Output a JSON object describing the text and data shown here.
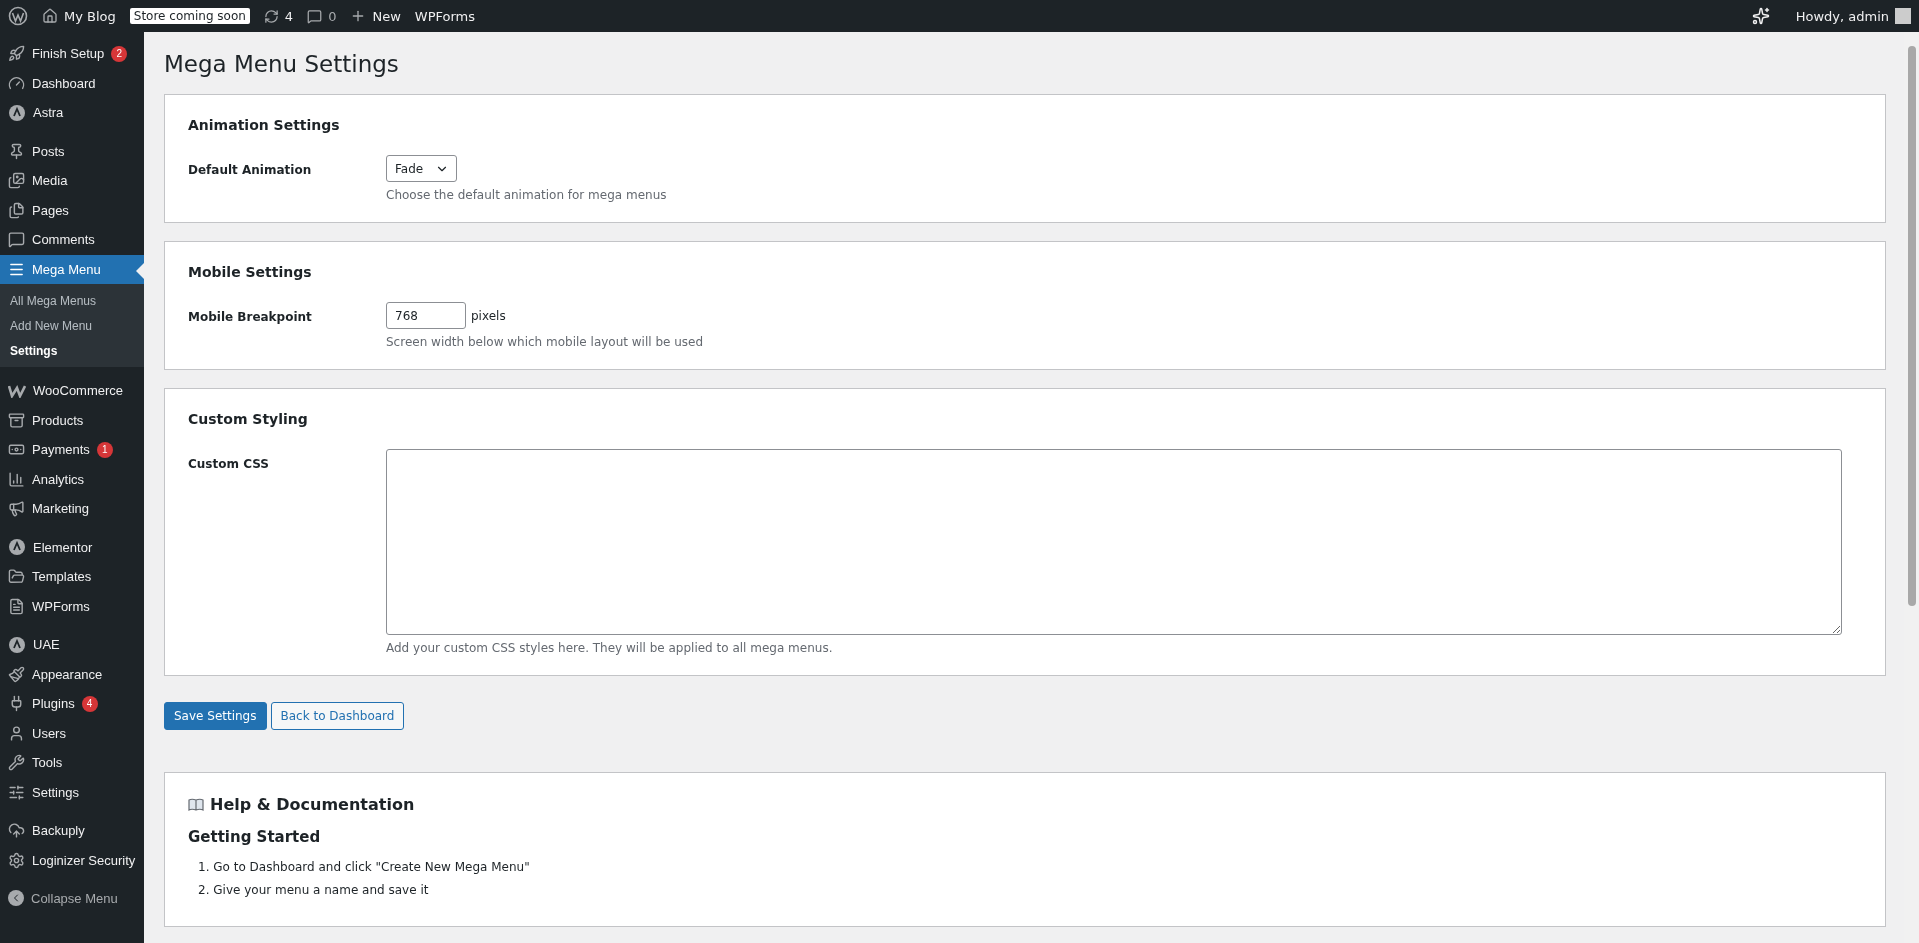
{
  "admin_bar": {
    "site_name": "My Blog",
    "store_notice": "Store coming soon",
    "updates": "4",
    "comments": "0",
    "new_label": "New",
    "plugin_link": "WPForms",
    "greeting": "Howdy, admin"
  },
  "sidebar": {
    "groups": [
      {
        "items": [
          {
            "label": "Finish Setup",
            "badge": "2",
            "selected": false
          },
          {
            "label": "Dashboard",
            "selected": false
          },
          {
            "label": "Astra",
            "selected": false
          }
        ]
      },
      {
        "items": [
          {
            "label": "Posts",
            "selected": false
          },
          {
            "label": "Media",
            "selected": false
          },
          {
            "label": "Pages",
            "selected": false
          },
          {
            "label": "Comments",
            "selected": false
          },
          {
            "label": "Mega Menu",
            "selected": true,
            "children": [
              {
                "label": "All Mega Menus",
                "selected": false
              },
              {
                "label": "Add New Menu",
                "selected": false
              },
              {
                "label": "Settings",
                "selected": true
              }
            ]
          }
        ]
      },
      {
        "items": [
          {
            "label": "WooCommerce",
            "selected": false
          },
          {
            "label": "Products",
            "selected": false
          },
          {
            "label": "Payments",
            "badge": "1",
            "selected": false
          },
          {
            "label": "Analytics",
            "selected": false
          },
          {
            "label": "Marketing",
            "selected": false
          }
        ]
      },
      {
        "items": [
          {
            "label": "Elementor",
            "selected": false
          },
          {
            "label": "Templates",
            "selected": false
          },
          {
            "label": "WPForms",
            "selected": false
          }
        ]
      },
      {
        "items": [
          {
            "label": "UAE",
            "selected": false
          },
          {
            "label": "Appearance",
            "selected": false
          },
          {
            "label": "Plugins",
            "badge": "4",
            "selected": false
          },
          {
            "label": "Users",
            "selected": false
          },
          {
            "label": "Tools",
            "selected": false
          },
          {
            "label": "Settings",
            "selected": false
          }
        ]
      },
      {
        "items": [
          {
            "label": "Backuply",
            "selected": false
          },
          {
            "label": "Loginizer Security",
            "selected": false
          }
        ]
      }
    ],
    "collapse": "Collapse Menu"
  },
  "page_title": "Mega Menu Settings",
  "sections": [
    {
      "title": "Animation Settings",
      "fields": [
        {
          "kind": "select",
          "label": "Default Animation",
          "value": "Fade",
          "description": "Choose the default animation for mega menus"
        }
      ]
    },
    {
      "title": "Mobile Settings",
      "fields": [
        {
          "kind": "number",
          "label": "Mobile Breakpoint",
          "value": "768",
          "unit": "pixels",
          "description": "Screen width below which mobile layout will be used"
        }
      ]
    },
    {
      "title": "Custom Styling",
      "fields": [
        {
          "kind": "textarea",
          "label": "Custom CSS",
          "description": "Add your custom CSS styles here. They will be applied to all mega menus."
        }
      ]
    }
  ],
  "buttons": [
    {
      "kind": "primary",
      "label": "Save Settings"
    },
    {
      "kind": "secondary",
      "label": "Back to Dashboard"
    }
  ],
  "help": {
    "title": "Help & Documentation",
    "subtitle": "Getting Started",
    "steps": [
      "1. Go to Dashboard and click \"Create New Mega Menu\"",
      "2. Give your menu a name and save it"
    ]
  }
}
